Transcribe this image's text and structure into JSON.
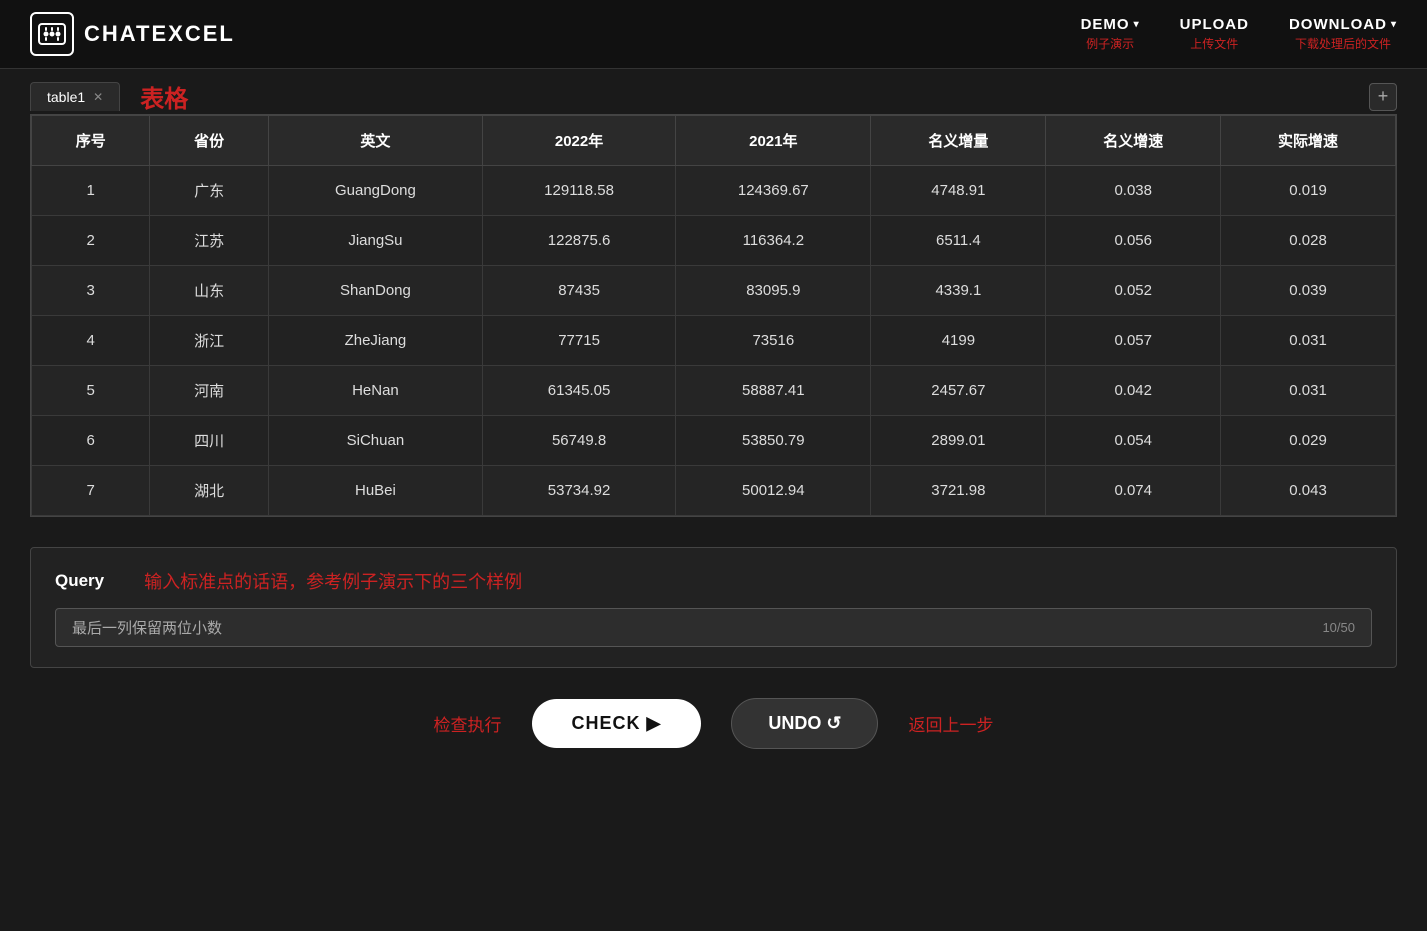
{
  "header": {
    "logo_text": "ChatExcel",
    "nav": [
      {
        "id": "demo",
        "label": "DEMO",
        "sub": "例子演示",
        "has_chevron": true
      },
      {
        "id": "upload",
        "label": "UPLOAD",
        "sub": "上传文件",
        "has_chevron": false
      },
      {
        "id": "download",
        "label": "DOWNLOAD",
        "sub": "下载处理后的文件",
        "has_chevron": true
      }
    ]
  },
  "tab": {
    "name": "table1",
    "title": "表格",
    "add_label": "+"
  },
  "table": {
    "columns": [
      "序号",
      "省份",
      "英文",
      "2022年",
      "2021年",
      "名义增量",
      "名义增速",
      "实际增速"
    ],
    "rows": [
      [
        "1",
        "广东",
        "GuangDong",
        "129118.58",
        "124369.67",
        "4748.91",
        "0.038",
        "0.019"
      ],
      [
        "2",
        "江苏",
        "JiangSu",
        "122875.6",
        "116364.2",
        "6511.4",
        "0.056",
        "0.028"
      ],
      [
        "3",
        "山东",
        "ShanDong",
        "87435",
        "83095.9",
        "4339.1",
        "0.052",
        "0.039"
      ],
      [
        "4",
        "浙江",
        "ZheJiang",
        "77715",
        "73516",
        "4199",
        "0.057",
        "0.031"
      ],
      [
        "5",
        "河南",
        "HeNan",
        "61345.05",
        "58887.41",
        "2457.67",
        "0.042",
        "0.031"
      ],
      [
        "6",
        "四川",
        "SiChuan",
        "56749.8",
        "53850.79",
        "2899.01",
        "0.054",
        "0.029"
      ],
      [
        "7",
        "湖北",
        "HuBei",
        "53734.92",
        "50012.94",
        "3721.98",
        "0.074",
        "0.043"
      ]
    ]
  },
  "query": {
    "label": "Query",
    "hint": "输入标准点的话语，参考例子演示下的三个样例",
    "placeholder": "最后一列保留两位小数",
    "input_value": "最后一列保留两位小数",
    "counter": "10/50"
  },
  "actions": {
    "check_prefix_label": "检查执行",
    "check_button_label": "CHECK ▶",
    "undo_button_label": "UNDO ↺",
    "undo_suffix_label": "返回上一步"
  }
}
